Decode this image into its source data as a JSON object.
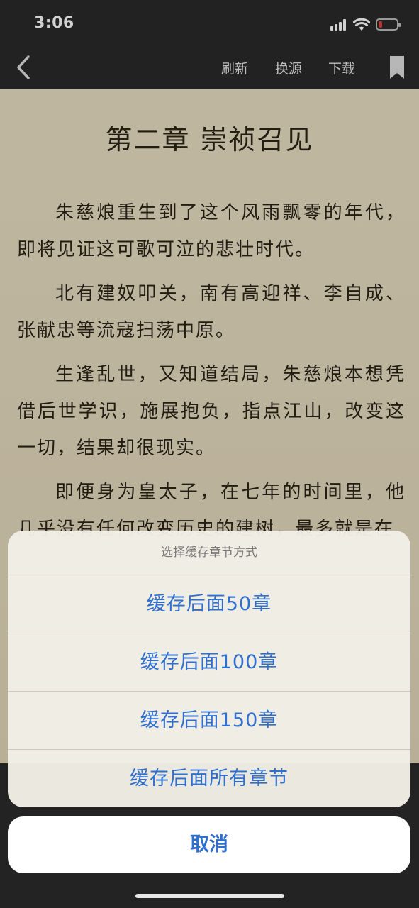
{
  "status_bar": {
    "time": "3:06",
    "battery_color": "#e0423a",
    "battery_level": 0.2
  },
  "nav": {
    "refresh": "刷新",
    "switch_source": "换源",
    "download": "下载"
  },
  "chapter": {
    "title": "第二章  崇祯召见",
    "paragraphs": [
      "朱慈烺重生到了这个风雨飘零的年代，即将见证这可歌可泣的悲壮时代。",
      "北有建奴叩关，南有高迎祥、李自成、张献忠等流寇扫荡中原。",
      "生逢乱世，又知道结局，朱慈烺本想凭借后世学识，施展抱负，指点江山，改变这一切，结果却很现实。",
      "即便身为皇太子，在七年的时间里，他几乎没有任何改变历史的建树，最多就是在"
    ]
  },
  "sheet": {
    "title": "选择缓存章节方式",
    "options": [
      "缓存后面50章",
      "缓存后面100章",
      "缓存后面150章",
      "缓存后面所有章节"
    ],
    "cancel": "取消"
  },
  "colors": {
    "accent": "#2e6fd0",
    "paper": "#e9dfc4",
    "bar": "#2a2a2a"
  }
}
